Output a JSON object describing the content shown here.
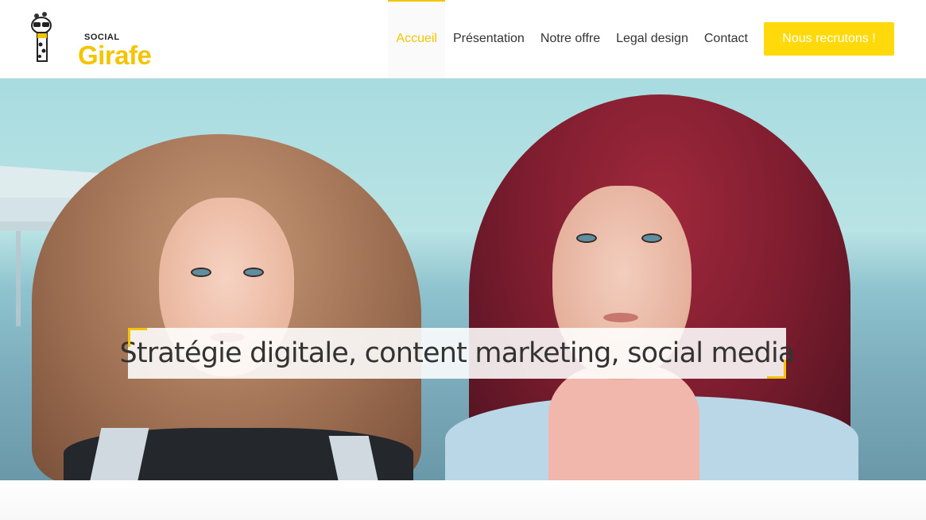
{
  "logo": {
    "small_text": "SOCIAL",
    "big_text": "Girafe"
  },
  "nav": {
    "items": [
      {
        "label": "Accueil",
        "active": true
      },
      {
        "label": "Présentation",
        "active": false
      },
      {
        "label": "Notre offre",
        "active": false
      },
      {
        "label": "Legal design",
        "active": false
      },
      {
        "label": "Contact",
        "active": false
      }
    ],
    "cta_label": "Nous recrutons !"
  },
  "hero": {
    "caption": "Stratégie digitale, content marketing, social media"
  },
  "colors": {
    "accent": "#f5c400",
    "cta_bg": "#ffd90a"
  }
}
